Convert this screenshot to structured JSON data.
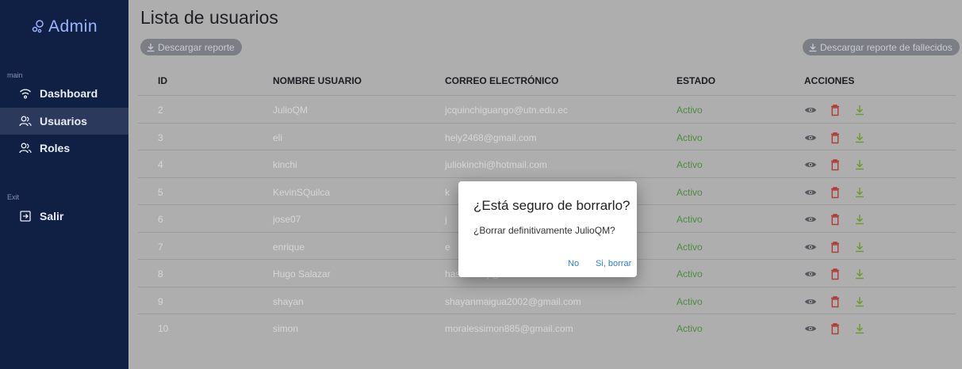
{
  "sidebar": {
    "brand": "Admin",
    "section_main": "main",
    "section_exit": "Exit",
    "items": [
      {
        "label": "Dashboard",
        "icon": "wifi-icon"
      },
      {
        "label": "Usuarios",
        "icon": "users-icon"
      },
      {
        "label": "Roles",
        "icon": "users-icon"
      }
    ],
    "exit_item": {
      "label": "Salir",
      "icon": "logout-icon"
    }
  },
  "page": {
    "title": "Lista de usuarios",
    "download_report": "Descargar reporte",
    "download_deceased_report": "Descargar reporte de fallecidos"
  },
  "table": {
    "headers": {
      "id": "ID",
      "name": "NOMBRE USUARIO",
      "email": "CORREO ELECTRÓNICO",
      "state": "ESTADO",
      "actions": "ACCIONES"
    },
    "rows": [
      {
        "id": "2",
        "name": "JulioQM",
        "email": "jcquinchiguango@utn.edu.ec",
        "state": "Activo"
      },
      {
        "id": "3",
        "name": "eli",
        "email": "hely2468@gmail.com",
        "state": "Activo"
      },
      {
        "id": "4",
        "name": "kinchi",
        "email": "juliokinchi@hotmail.com",
        "state": "Activo"
      },
      {
        "id": "5",
        "name": "KevinSQuilca",
        "email": "k",
        "state": "Activo"
      },
      {
        "id": "6",
        "name": "jose07",
        "email": "j",
        "state": "Activo"
      },
      {
        "id": "7",
        "name": "enrique",
        "email": "e",
        "state": "Activo"
      },
      {
        "id": "8",
        "name": "Hugo Salazar",
        "email": "hasalazary@utn.edu.ec",
        "state": "Activo"
      },
      {
        "id": "9",
        "name": "shayan",
        "email": "shayanmaigua2002@gmail.com",
        "state": "Activo"
      },
      {
        "id": "10",
        "name": "simon",
        "email": "moralessimon885@gmail.com",
        "state": "Activo"
      }
    ]
  },
  "dialog": {
    "title": "¿Está seguro de borrarlo?",
    "message": "¿Borrar definitivamente JulioQM?",
    "cancel": "No",
    "confirm": "Si, borrar"
  },
  "colors": {
    "sidebar_bg": "#0f2044",
    "active_item_bg": "#2b3a5c",
    "state_active": "#4e8a3e",
    "view_icon": "#55575f",
    "delete_icon": "#b23a35",
    "download_icon": "#6f9b2c",
    "dialog_button": "#2a7de1"
  }
}
